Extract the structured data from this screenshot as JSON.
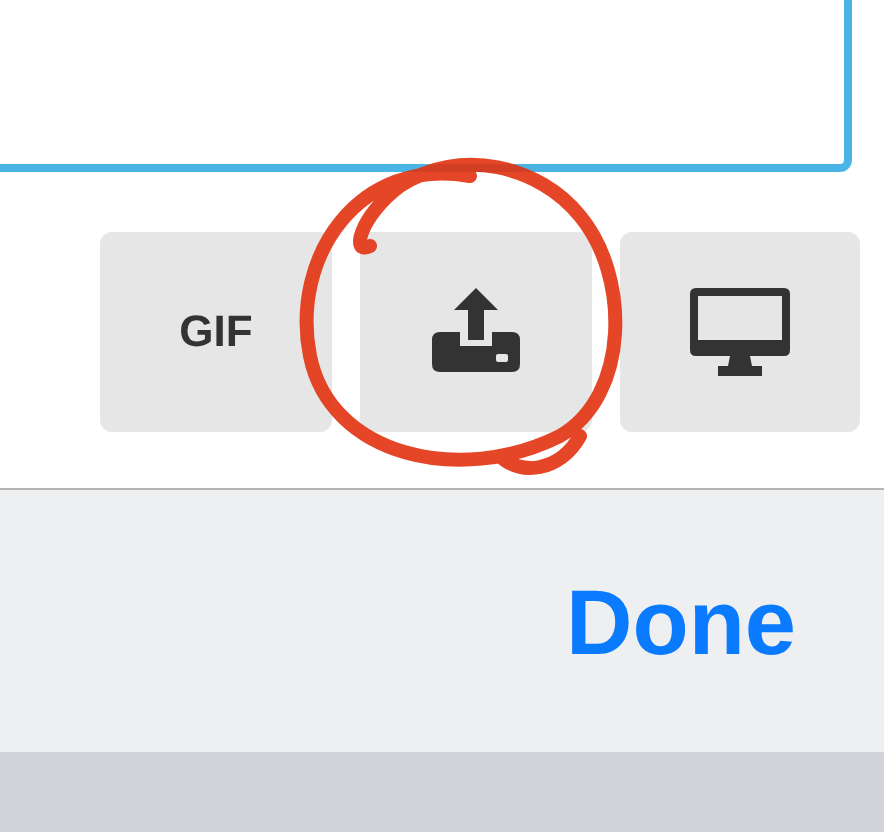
{
  "buttons": [
    {
      "kind": "text",
      "label": "GIF"
    },
    {
      "kind": "upload"
    },
    {
      "kind": "monitor"
    }
  ],
  "done_button": {
    "label": "Done"
  }
}
